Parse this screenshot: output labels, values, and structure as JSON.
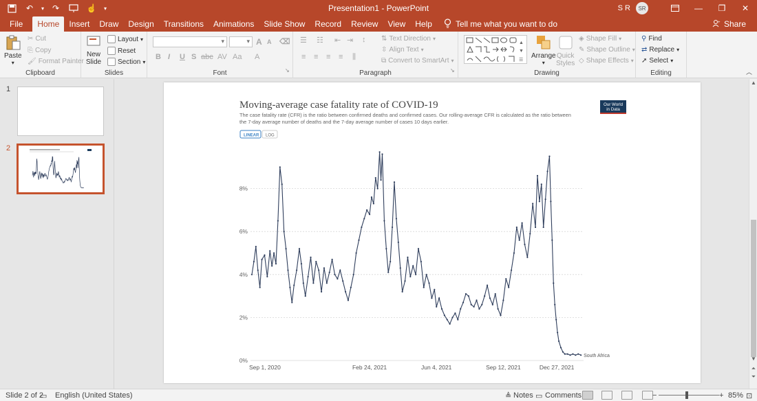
{
  "window": {
    "title": "Presentation1  -  PowerPoint",
    "user_initials": "S R",
    "avatar_text": "SR"
  },
  "tabs": [
    "File",
    "Home",
    "Insert",
    "Draw",
    "Design",
    "Transitions",
    "Animations",
    "Slide Show",
    "Record",
    "Review",
    "View",
    "Help"
  ],
  "active_tab": "Home",
  "tell_me": "Tell me what you want to do",
  "share_label": "Share",
  "ribbon": {
    "clipboard": {
      "paste": "Paste",
      "cut": "Cut",
      "copy": "Copy",
      "format_painter": "Format Painter",
      "label": "Clipboard"
    },
    "slides": {
      "new_slide": "New",
      "new_slide2": "Slide",
      "layout": "Layout",
      "reset": "Reset",
      "section": "Section",
      "label": "Slides"
    },
    "font": {
      "label": "Font",
      "bold": "B",
      "italic": "I",
      "underline": "U",
      "strike": "S",
      "abc": "abc",
      "aa": "Aa",
      "grow": "A",
      "shrink": "A"
    },
    "paragraph": {
      "label": "Paragraph",
      "text_direction": "Text Direction",
      "align_text": "Align Text",
      "smartart": "Convert to SmartArt"
    },
    "drawing": {
      "label": "Drawing",
      "arrange": "Arrange",
      "quick_styles": "Quick",
      "quick_styles2": "Styles",
      "shape_fill": "Shape Fill",
      "shape_outline": "Shape Outline",
      "shape_effects": "Shape Effects"
    },
    "editing": {
      "label": "Editing",
      "find": "Find",
      "replace": "Replace",
      "select": "Select"
    }
  },
  "thumbnails": {
    "first": "1",
    "second": "2"
  },
  "slide": {
    "title": "Moving-average case fatality rate of COVID-19",
    "subtitle_line1": "The case fatality rate (CFR) is the ratio between confirmed deaths and confirmed cases. Our rolling-average CFR is calculated as the ratio between",
    "subtitle_line2": "the 7-day average number of deaths and the 7-day average number of cases 10 days earlier.",
    "toggle_linear": "LINEAR",
    "toggle_log": "LOG",
    "logo_line1": "Our World",
    "logo_line2": "in Data",
    "logo_bg": "#1a3a5c",
    "logo_accent": "#c0392b"
  },
  "chart_data": {
    "type": "line",
    "title": "Moving-average case fatality rate of COVID-19",
    "xlabel": "",
    "ylabel": "",
    "x_tick_labels": [
      "Sep 1, 2020",
      "Feb 24, 2021",
      "Jun 4, 2021",
      "Sep 12, 2021",
      "Dec 27, 2021"
    ],
    "y_tick_labels": [
      "0%",
      "2%",
      "4%",
      "6%",
      "8%"
    ],
    "ylim": [
      0,
      10
    ],
    "xlim": [
      "2020-09-01",
      "2022-01-10"
    ],
    "grid": "horizontal dotted",
    "series": [
      {
        "name": "South Africa",
        "color": "#2f3e5c",
        "points": [
          [
            "2020-09-01",
            4.0
          ],
          [
            "2020-09-04",
            4.6
          ],
          [
            "2020-09-07",
            5.3
          ],
          [
            "2020-09-10",
            4.2
          ],
          [
            "2020-09-13",
            3.4
          ],
          [
            "2020-09-16",
            4.7
          ],
          [
            "2020-09-20",
            4.9
          ],
          [
            "2020-09-24",
            3.9
          ],
          [
            "2020-09-28",
            5.1
          ],
          [
            "2020-10-01",
            4.4
          ],
          [
            "2020-10-04",
            5.0
          ],
          [
            "2020-10-07",
            4.5
          ],
          [
            "2020-10-10",
            6.5
          ],
          [
            "2020-10-13",
            9.0
          ],
          [
            "2020-10-16",
            8.2
          ],
          [
            "2020-10-19",
            6.0
          ],
          [
            "2020-10-22",
            5.2
          ],
          [
            "2020-10-25",
            4.2
          ],
          [
            "2020-10-28",
            3.4
          ],
          [
            "2020-10-31",
            2.7
          ],
          [
            "2020-11-03",
            3.5
          ],
          [
            "2020-11-07",
            4.2
          ],
          [
            "2020-11-11",
            5.2
          ],
          [
            "2020-11-14",
            4.5
          ],
          [
            "2020-11-17",
            3.6
          ],
          [
            "2020-11-20",
            3.0
          ],
          [
            "2020-11-24",
            3.9
          ],
          [
            "2020-11-28",
            4.8
          ],
          [
            "2020-12-02",
            3.6
          ],
          [
            "2020-12-06",
            4.6
          ],
          [
            "2020-12-10",
            4.2
          ],
          [
            "2020-12-14",
            3.2
          ],
          [
            "2020-12-18",
            4.3
          ],
          [
            "2020-12-22",
            3.6
          ],
          [
            "2020-12-26",
            4.1
          ],
          [
            "2020-12-30",
            4.7
          ],
          [
            "2021-01-03",
            4.0
          ],
          [
            "2021-01-07",
            3.8
          ],
          [
            "2021-01-11",
            4.2
          ],
          [
            "2021-01-15",
            3.7
          ],
          [
            "2021-01-19",
            3.2
          ],
          [
            "2021-01-23",
            2.8
          ],
          [
            "2021-01-27",
            3.4
          ],
          [
            "2021-01-31",
            4.0
          ],
          [
            "2021-02-04",
            5.0
          ],
          [
            "2021-02-08",
            5.6
          ],
          [
            "2021-02-12",
            6.2
          ],
          [
            "2021-02-16",
            6.6
          ],
          [
            "2021-02-20",
            7.0
          ],
          [
            "2021-02-24",
            6.8
          ],
          [
            "2021-02-27",
            7.6
          ],
          [
            "2021-03-02",
            7.3
          ],
          [
            "2021-03-05",
            8.5
          ],
          [
            "2021-03-08",
            8.0
          ],
          [
            "2021-03-11",
            9.7
          ],
          [
            "2021-03-13",
            8.4
          ],
          [
            "2021-03-15",
            9.6
          ],
          [
            "2021-03-18",
            6.5
          ],
          [
            "2021-03-21",
            5.2
          ],
          [
            "2021-03-24",
            4.1
          ],
          [
            "2021-03-27",
            4.6
          ],
          [
            "2021-03-30",
            6.2
          ],
          [
            "2021-04-02",
            8.3
          ],
          [
            "2021-04-05",
            6.6
          ],
          [
            "2021-04-08",
            5.5
          ],
          [
            "2021-04-11",
            4.3
          ],
          [
            "2021-04-14",
            3.2
          ],
          [
            "2021-04-18",
            3.7
          ],
          [
            "2021-04-22",
            4.8
          ],
          [
            "2021-04-26",
            3.9
          ],
          [
            "2021-04-30",
            4.4
          ],
          [
            "2021-05-04",
            4.0
          ],
          [
            "2021-05-08",
            5.2
          ],
          [
            "2021-05-12",
            4.6
          ],
          [
            "2021-05-16",
            3.4
          ],
          [
            "2021-05-20",
            4.0
          ],
          [
            "2021-05-24",
            3.6
          ],
          [
            "2021-05-28",
            2.9
          ],
          [
            "2021-06-01",
            3.3
          ],
          [
            "2021-06-04",
            2.5
          ],
          [
            "2021-06-08",
            2.9
          ],
          [
            "2021-06-12",
            2.4
          ],
          [
            "2021-06-16",
            2.1
          ],
          [
            "2021-06-20",
            1.9
          ],
          [
            "2021-06-24",
            1.7
          ],
          [
            "2021-06-28",
            2.0
          ],
          [
            "2021-07-02",
            2.2
          ],
          [
            "2021-07-06",
            1.9
          ],
          [
            "2021-07-10",
            2.4
          ],
          [
            "2021-07-14",
            2.7
          ],
          [
            "2021-07-18",
            3.1
          ],
          [
            "2021-07-22",
            3.0
          ],
          [
            "2021-07-26",
            2.6
          ],
          [
            "2021-07-30",
            2.5
          ],
          [
            "2021-08-03",
            2.8
          ],
          [
            "2021-08-07",
            2.4
          ],
          [
            "2021-08-11",
            2.6
          ],
          [
            "2021-08-15",
            3.0
          ],
          [
            "2021-08-19",
            3.5
          ],
          [
            "2021-08-23",
            2.9
          ],
          [
            "2021-08-27",
            2.6
          ],
          [
            "2021-08-31",
            3.1
          ],
          [
            "2021-09-04",
            2.4
          ],
          [
            "2021-09-08",
            2.1
          ],
          [
            "2021-09-12",
            2.8
          ],
          [
            "2021-09-16",
            3.8
          ],
          [
            "2021-09-20",
            3.4
          ],
          [
            "2021-09-24",
            4.2
          ],
          [
            "2021-09-28",
            5.0
          ],
          [
            "2021-10-02",
            6.2
          ],
          [
            "2021-10-06",
            5.6
          ],
          [
            "2021-10-10",
            6.4
          ],
          [
            "2021-10-14",
            5.4
          ],
          [
            "2021-10-18",
            4.8
          ],
          [
            "2021-10-22",
            5.9
          ],
          [
            "2021-10-26",
            7.3
          ],
          [
            "2021-10-30",
            6.2
          ],
          [
            "2021-11-02",
            8.6
          ],
          [
            "2021-11-05",
            7.4
          ],
          [
            "2021-11-08",
            8.2
          ],
          [
            "2021-11-11",
            6.2
          ],
          [
            "2021-11-14",
            7.5
          ],
          [
            "2021-11-17",
            8.8
          ],
          [
            "2021-11-20",
            9.5
          ],
          [
            "2021-11-22",
            7.4
          ],
          [
            "2021-11-24",
            5.6
          ],
          [
            "2021-11-26",
            3.6
          ],
          [
            "2021-11-28",
            2.6
          ],
          [
            "2021-11-30",
            1.9
          ],
          [
            "2021-12-02",
            1.3
          ],
          [
            "2021-12-04",
            0.9
          ],
          [
            "2021-12-07",
            0.6
          ],
          [
            "2021-12-10",
            0.4
          ],
          [
            "2021-12-13",
            0.3
          ],
          [
            "2021-12-17",
            0.3
          ],
          [
            "2021-12-21",
            0.25
          ],
          [
            "2021-12-25",
            0.3
          ],
          [
            "2021-12-29",
            0.25
          ],
          [
            "2022-01-02",
            0.3
          ],
          [
            "2022-01-06",
            0.25
          ]
        ]
      }
    ]
  },
  "status": {
    "slide_of": "Slide 2 of 2",
    "language": "English (United States)",
    "notes": "Notes",
    "comments": "Comments",
    "zoom_minus": "−",
    "zoom_plus": "+",
    "zoom": "85%"
  }
}
